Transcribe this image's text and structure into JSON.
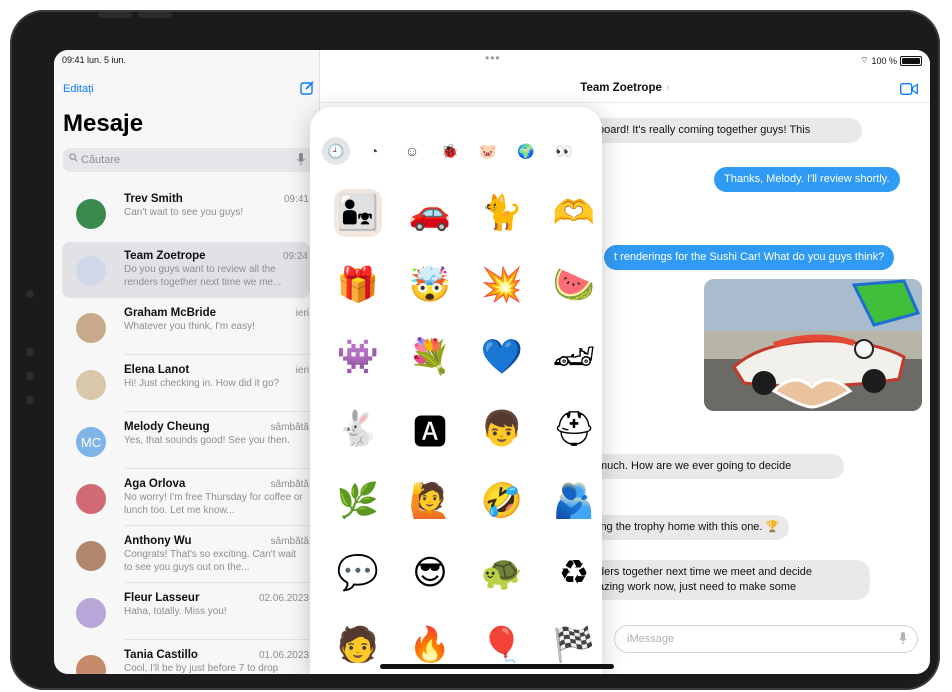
{
  "status_bar": {
    "time": "09:41  lun. 5 iun.",
    "multitask_dots": "•••",
    "battery_label": "100 %"
  },
  "sidebar": {
    "edit_label": "Editați",
    "title": "Mesaje",
    "search_placeholder": "Căutare",
    "conversations": [
      {
        "name": "Trev Smith",
        "time": "09:41",
        "preview": "Can't wait to see you guys!",
        "avatar_color": "#3a8a4e"
      },
      {
        "name": "Team Zoetrope",
        "time": "09:24",
        "preview": "Do you guys want to review all the renders together next time we me...",
        "avatar_color": "#cfd8e8"
      },
      {
        "name": "Graham McBride",
        "time": "ieri",
        "preview": "Whatever you think, I'm easy!",
        "avatar_color": "#c8a98a"
      },
      {
        "name": "Elena Lanot",
        "time": "ieri",
        "preview": "Hi! Just checking in. How did it go?",
        "avatar_color": "#d8c7a8"
      },
      {
        "name": "Melody Cheung",
        "time": "sâmbătă",
        "preview": "Yes, that sounds good! See you then.",
        "avatar_initials": "MC",
        "avatar_color": "#7fb4e6"
      },
      {
        "name": "Aga Orlova",
        "time": "sâmbătă",
        "preview": "No worry! I'm free Thursday for coffee or lunch too. Let me know...",
        "avatar_color": "#d26a74"
      },
      {
        "name": "Anthony Wu",
        "time": "sâmbătă",
        "preview": "Congrats! That's so exciting. Can't wait to see you guys out on the...",
        "avatar_color": "#b0876a"
      },
      {
        "name": "Fleur Lasseur",
        "time": "02.06.2023",
        "preview": "Haha, totally. Miss you!",
        "avatar_color": "#b8a6d8"
      },
      {
        "name": "Tania Castillo",
        "time": "01.06.2023",
        "preview": "Cool, I'll be by just before 7 to drop",
        "avatar_color": "#c58a6a"
      }
    ]
  },
  "chat": {
    "title": "Team Zoetrope",
    "title_chevron": "›",
    "messages": [
      {
        "text": "board! It's really coming together guys! This",
        "side": "in"
      },
      {
        "text": "Thanks, Melody. I'll review shortly.",
        "side": "out"
      },
      {
        "text": "t renderings for the Sushi Car! What do you guys think?",
        "side": "out"
      },
      {
        "text": "much. How are we ever going to decide",
        "side": "in"
      },
      {
        "text": "ing the trophy home with this one. 🏆",
        "side": "in"
      },
      {
        "text": "ders together next time we meet and decide\nazing work now, just need to make some",
        "side": "in"
      }
    ],
    "input_placeholder": "iMessage"
  },
  "sticker_drawer": {
    "tabs": [
      {
        "icon": "clock-icon",
        "glyph": "🕘",
        "selected": true
      },
      {
        "icon": "sticker-peel-icon",
        "glyph": "◔"
      },
      {
        "icon": "smiley-icon",
        "glyph": "☺"
      },
      {
        "icon": "ladybug-icon",
        "glyph": "🐞"
      },
      {
        "icon": "animoji-pig-icon",
        "glyph": "🐷"
      },
      {
        "icon": "planet-icon",
        "glyph": "🌍"
      },
      {
        "icon": "eyes-sticker-icon",
        "glyph": "👀"
      }
    ],
    "stickers": [
      {
        "name": "family-photo-sticker",
        "glyph": "👨‍👧",
        "bg": "#f3e8df"
      },
      {
        "name": "red-car-sticker",
        "glyph": "🚗",
        "bg": "#ffffff"
      },
      {
        "name": "dancing-cat-sticker",
        "glyph": "🐈",
        "bg": "#ffffff"
      },
      {
        "name": "heart-hands-sticker",
        "glyph": "🫶",
        "bg": "#ffffff"
      },
      {
        "name": "gift-sticker",
        "glyph": "🎁",
        "bg": "#ffffff"
      },
      {
        "name": "mind-blown-memoji-sticker",
        "glyph": "🤯",
        "bg": "#ffffff"
      },
      {
        "name": "zoom-text-sticker",
        "glyph": "💥",
        "bg": "#ffffff"
      },
      {
        "name": "watermelon-sticker",
        "glyph": "🍉",
        "bg": "#ffffff"
      },
      {
        "name": "monster-mouth-sticker",
        "glyph": "👾",
        "bg": "#ffffff"
      },
      {
        "name": "flower-bouquet-sticker",
        "glyph": "💐",
        "bg": "#ffffff"
      },
      {
        "name": "blue-heart-sticker",
        "glyph": "💙",
        "bg": "#ffffff"
      },
      {
        "name": "flame-car-sticker",
        "glyph": "🏎",
        "bg": "#ffffff"
      },
      {
        "name": "rabbit-sticker",
        "glyph": "🐇",
        "bg": "#ffffff"
      },
      {
        "name": "a-plus-sticker",
        "glyph": "🅰",
        "bg": "#ffffff"
      },
      {
        "name": "portrait-sticker",
        "glyph": "👦",
        "bg": "#ffffff"
      },
      {
        "name": "red-helmet-sticker",
        "glyph": "⛑",
        "bg": "#ffffff"
      },
      {
        "name": "monstera-leaf-sticker",
        "glyph": "🌿",
        "bg": "#ffffff"
      },
      {
        "name": "memoji-girl-sticker",
        "glyph": "🙋",
        "bg": "#ffffff"
      },
      {
        "name": "laughing-emoji-sticker",
        "glyph": "🤣",
        "bg": "#ffffff"
      },
      {
        "name": "hug-photo-sticker",
        "glyph": "🫂",
        "bg": "#ffffff"
      },
      {
        "name": "go-text-sticker",
        "glyph": "💬",
        "bg": "#ffffff"
      },
      {
        "name": "sunglasses-memoji-sticker",
        "glyph": "😎",
        "bg": "#ffffff"
      },
      {
        "name": "turtle-sticker",
        "glyph": "🐢",
        "bg": "#ffffff"
      },
      {
        "name": "recycle-sticker",
        "glyph": "♻",
        "bg": "#ffffff"
      },
      {
        "name": "person-photo-sticker",
        "glyph": "🧑",
        "bg": "#ffffff"
      },
      {
        "name": "red-text-sticker",
        "glyph": "🔥",
        "bg": "#ffffff"
      },
      {
        "name": "balloon-sticker",
        "glyph": "🎈",
        "bg": "#ffffff"
      },
      {
        "name": "checkered-flag-sticker",
        "glyph": "🏁",
        "bg": "#ffffff"
      }
    ]
  },
  "colors": {
    "accent": "#0a7cff",
    "outgoing_bubble": "#2f9bf5",
    "incoming_bubble": "#e9e9eb",
    "sidebar_bg": "#f7f7f8"
  }
}
